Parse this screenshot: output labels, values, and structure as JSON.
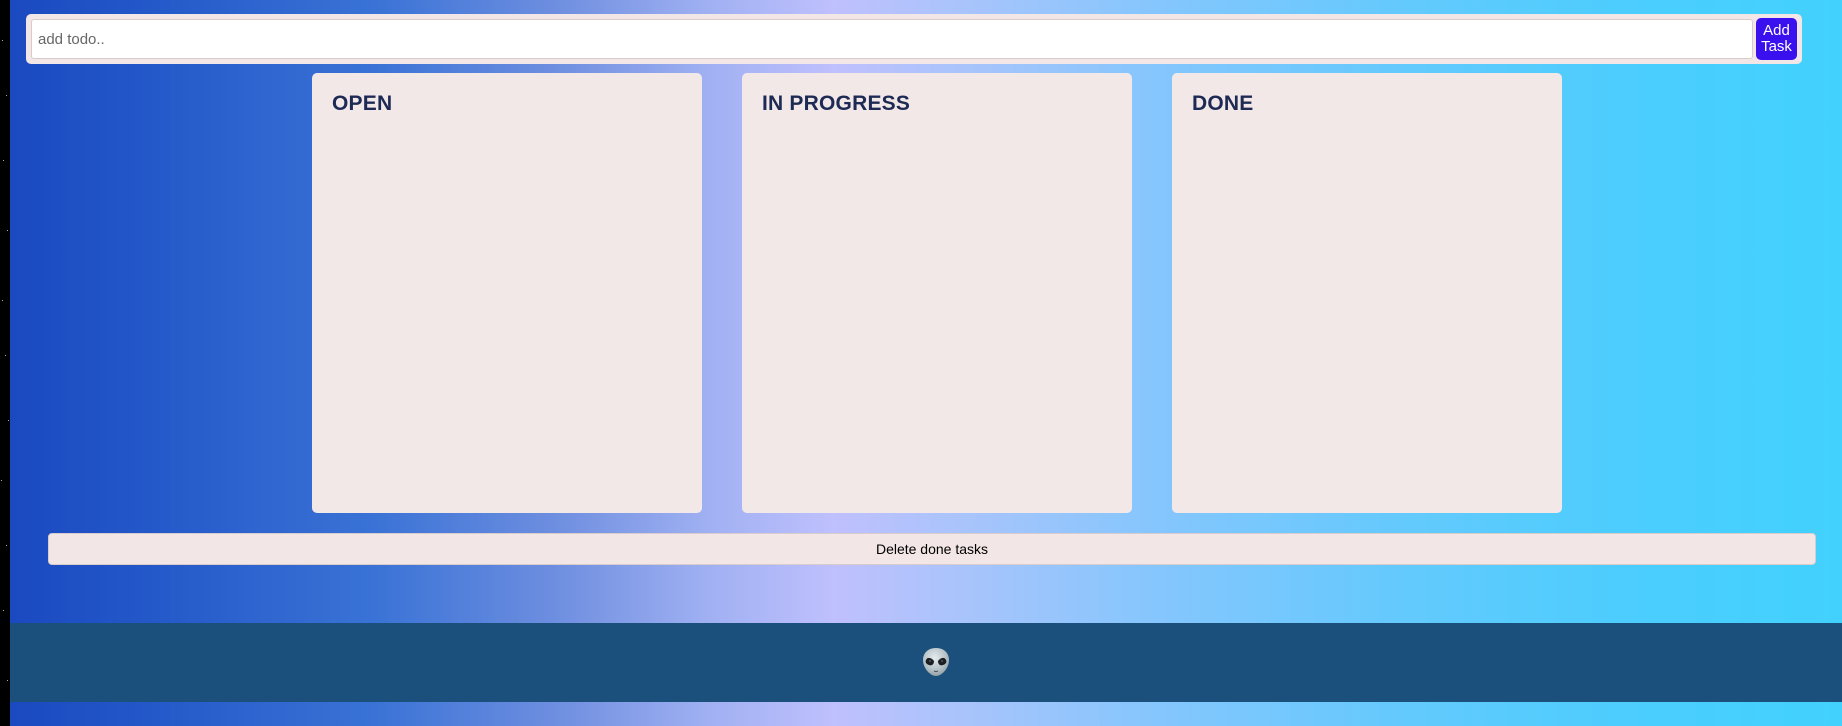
{
  "todo_input": {
    "placeholder": "add todo..",
    "value": ""
  },
  "add_button": {
    "label": "Add Task"
  },
  "columns": [
    {
      "title": "OPEN"
    },
    {
      "title": "IN PROGRESS"
    },
    {
      "title": "DONE"
    }
  ],
  "delete_button": {
    "label": "Delete done tasks"
  },
  "footer": {
    "icon": "alien-emoji-icon"
  },
  "colors": {
    "add_button_bg": "#3a10ee",
    "column_bg": "#f3e8e8",
    "column_title": "#1d2a54",
    "footer_bg": "#1b4f7c"
  }
}
